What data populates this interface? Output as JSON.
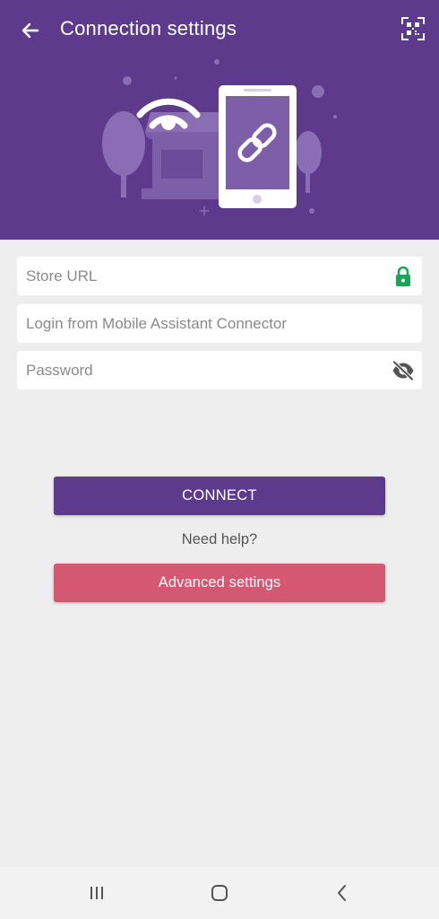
{
  "header": {
    "title": "Connection settings",
    "back_icon": "arrow-left-icon",
    "qr_icon": "qr-code-scan-icon",
    "background_color": "#5d3a8c",
    "illustration": "store-wifi-phone-link-illustration"
  },
  "form": {
    "store_url": {
      "placeholder": "Store URL",
      "value": "",
      "icon": "lock-icon",
      "icon_color": "#1aa55a"
    },
    "login": {
      "placeholder": "Login from Mobile Assistant Connector",
      "value": ""
    },
    "password": {
      "placeholder": "Password",
      "value": "",
      "icon": "eye-off-icon"
    }
  },
  "actions": {
    "connect_label": "CONNECT",
    "connect_color": "#5d3a8c",
    "help_label": "Need help?",
    "advanced_label": "Advanced settings",
    "advanced_color": "#d45872"
  },
  "system_nav": {
    "recents_icon": "recents-icon",
    "home_icon": "home-icon",
    "back_icon": "nav-back-icon"
  }
}
